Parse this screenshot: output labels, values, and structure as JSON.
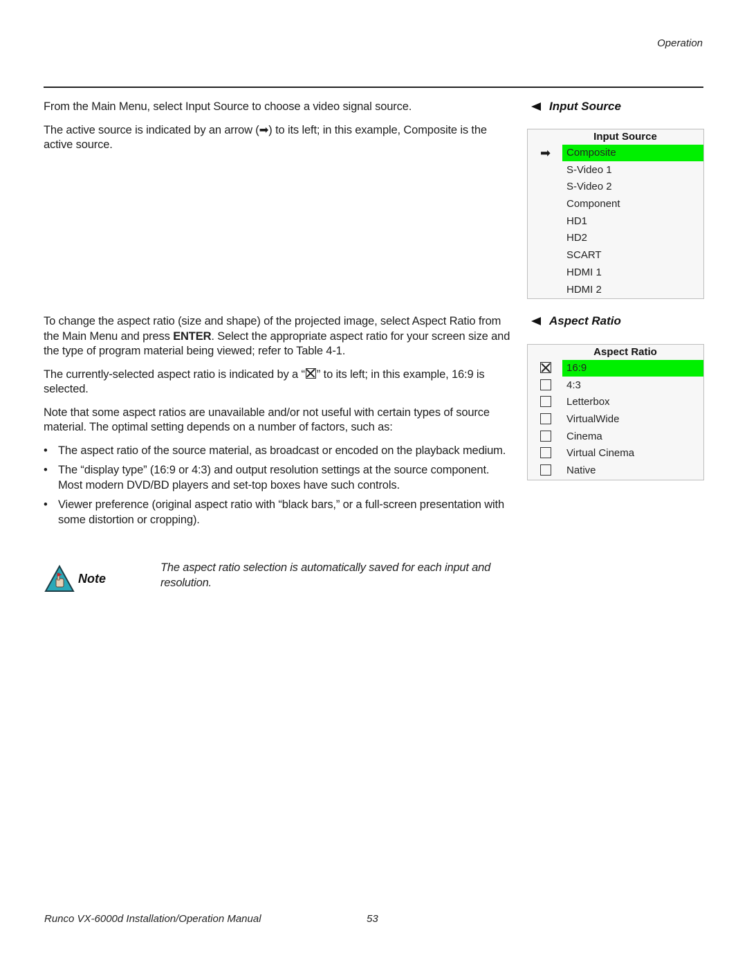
{
  "header": {
    "section": "Operation"
  },
  "input_source_text": {
    "p1": "From the Main Menu, select Input Source to choose a video signal source.",
    "p2": "The active source is indicated by an arrow (➡) to its left; in this example, Composite is the active source."
  },
  "input_source_heading": "Input Source",
  "input_source_menu": {
    "title": "Input Source",
    "active_marker": "➡",
    "items": [
      {
        "label": "Composite",
        "active": true
      },
      {
        "label": "S-Video 1"
      },
      {
        "label": "S-Video 2"
      },
      {
        "label": "Component"
      },
      {
        "label": "HD1"
      },
      {
        "label": "HD2"
      },
      {
        "label": "SCART"
      },
      {
        "label": "HDMI 1"
      },
      {
        "label": "HDMI 2"
      }
    ]
  },
  "aspect_text": {
    "p1_a": "To change the aspect ratio (size and shape) of the projected image, select Aspect Ratio from the Main Menu and press ",
    "p1_bold": "ENTER",
    "p1_b": ". Select the appropriate aspect ratio for your screen size and the type of program material being viewed; refer to Table 4-1.",
    "p2_a": "The currently-selected aspect ratio is indicated by a “",
    "p2_b": "” to its left; in this example, 16:9 is selected.",
    "p3": "Note that some aspect ratios are unavailable and/or not useful with certain types of source material. The optimal setting depends on a number of factors, such as:",
    "bullets": [
      "The aspect ratio of the source material, as broadcast or encoded on the playback medium.",
      "The “display type” (16:9 or 4:3) and output resolution settings at the source component. Most modern DVD/BD players and set-top boxes have such controls.",
      "Viewer preference (original aspect ratio with “black bars,” or a full-screen presentation with some distortion or cropping)."
    ],
    "bullet_glyph": "•"
  },
  "aspect_heading": "Aspect Ratio",
  "aspect_menu": {
    "title": "Aspect Ratio",
    "items": [
      {
        "label": "16:9",
        "selected": true
      },
      {
        "label": "4:3"
      },
      {
        "label": "Letterbox"
      },
      {
        "label": "VirtualWide"
      },
      {
        "label": "Cinema"
      },
      {
        "label": "Virtual Cinema"
      },
      {
        "label": "Native"
      }
    ]
  },
  "note": {
    "label": "Note",
    "text": "The aspect ratio selection is automatically saved for each input and resolution."
  },
  "footer": {
    "title": "Runco VX-6000d Installation/Operation Manual",
    "page": "53"
  },
  "colors": {
    "highlight": "#00f000",
    "menu_bg": "#f7f7f7",
    "note_icon": "#2aa8b8"
  }
}
